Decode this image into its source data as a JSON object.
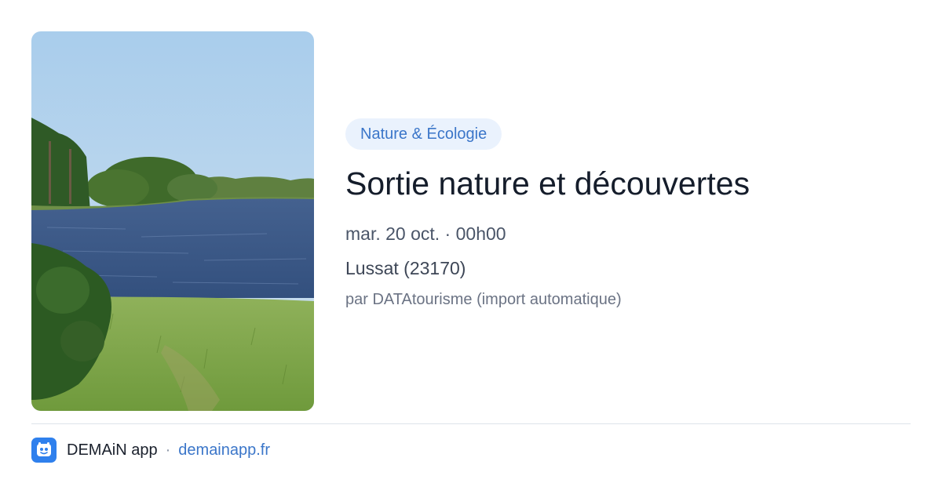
{
  "event": {
    "category": "Nature & Écologie",
    "title": "Sortie nature et découvertes",
    "datetime": "mar. 20 oct. · 00h00",
    "location": "Lussat (23170)",
    "author": "par DATAtourisme (import automatique)"
  },
  "footer": {
    "app_name": "DEMAiN app",
    "separator": "·",
    "url": "demainapp.fr"
  },
  "colors": {
    "accent": "#3b76c9",
    "pill_bg": "#eaf2fd",
    "title": "#151d2b",
    "logo_bg": "#2f80ed"
  },
  "icons": {
    "logo": "demain-app-logo-icon"
  }
}
